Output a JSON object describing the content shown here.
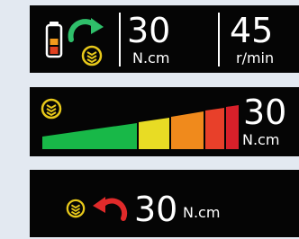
{
  "panel1": {
    "icons": {
      "battery": "battery-icon",
      "direction": "clockwise-arrow-icon",
      "mode": "speed-mode-icon"
    },
    "torque": {
      "value": "30",
      "unit": "N.cm"
    },
    "speed": {
      "value": "45",
      "unit": "r/min"
    }
  },
  "panel2": {
    "icons": {
      "mode": "speed-mode-icon"
    },
    "torque": {
      "value": "30",
      "unit": "N.cm"
    },
    "level_bar": {
      "segments": 5,
      "filled": 5,
      "colors": [
        "#18b848",
        "#e8dc24",
        "#f08a1c",
        "#e8402a",
        "#d8202a"
      ]
    }
  },
  "panel3": {
    "icons": {
      "mode": "speed-mode-icon",
      "direction": "counterclockwise-arrow-icon"
    },
    "torque": {
      "value": "30",
      "unit": "N.cm"
    }
  },
  "colors": {
    "accent_yellow": "#e7c81a",
    "arrow_green": "#2fbf6a",
    "arrow_red": "#e02a2a",
    "battery_red": "#e04020",
    "battery_orange": "#f39a1c"
  }
}
